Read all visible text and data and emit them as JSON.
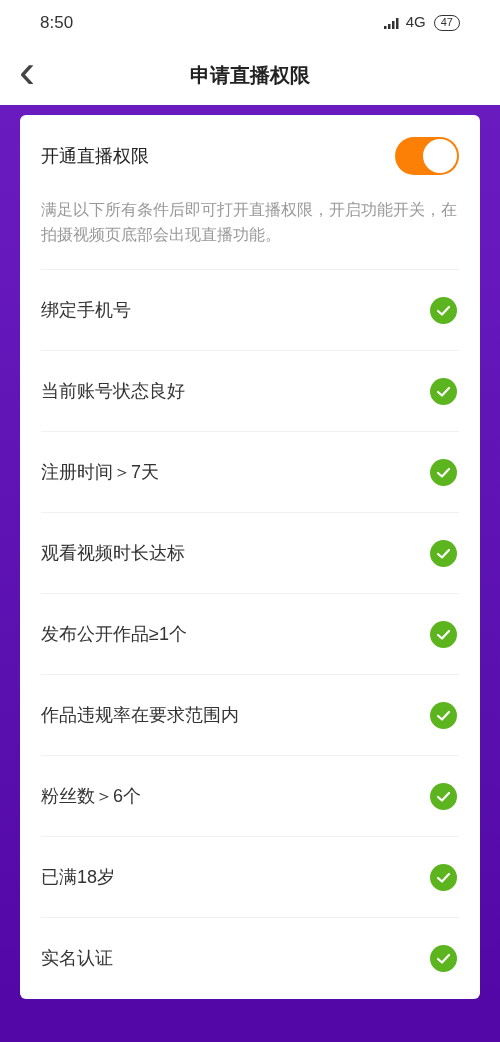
{
  "status_bar": {
    "time": "8:50",
    "network": "4G",
    "battery": "47"
  },
  "nav": {
    "back": "‹",
    "title": "申请直播权限"
  },
  "toggle_row": {
    "label": "开通直播权限",
    "on": true,
    "description": "满足以下所有条件后即可打开直播权限，开启功能开关，在拍摄视频页底部会出现直播功能。"
  },
  "conditions": [
    {
      "label": "绑定手机号",
      "checked": true
    },
    {
      "label": "当前账号状态良好",
      "checked": true
    },
    {
      "label": "注册时间＞7天",
      "checked": true
    },
    {
      "label": "观看视频时长达标",
      "checked": true
    },
    {
      "label": "发布公开作品≥1个",
      "checked": true
    },
    {
      "label": "作品违规率在要求范围内",
      "checked": true
    },
    {
      "label": "粉丝数＞6个",
      "checked": true
    },
    {
      "label": "已满18岁",
      "checked": true
    },
    {
      "label": "实名认证",
      "checked": true
    }
  ]
}
